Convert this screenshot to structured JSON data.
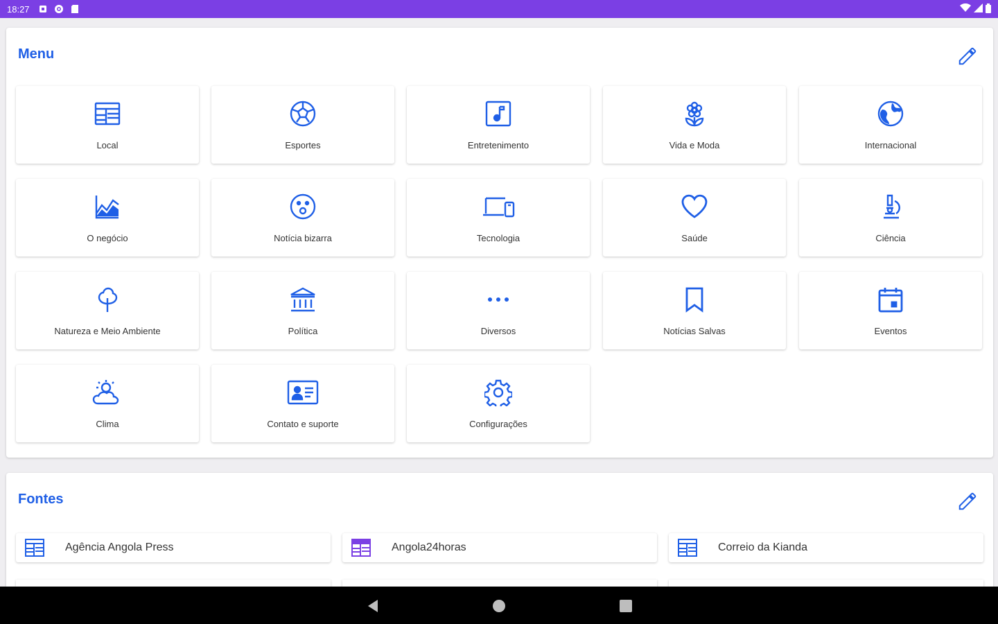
{
  "status_bar": {
    "time": "18:27"
  },
  "menu": {
    "title": "Menu",
    "items": [
      {
        "label": "Local",
        "icon": "local-news-icon"
      },
      {
        "label": "Esportes",
        "icon": "soccer-ball-icon"
      },
      {
        "label": "Entretenimento",
        "icon": "music-note-icon"
      },
      {
        "label": "Vida e Moda",
        "icon": "flower-icon"
      },
      {
        "label": "Internacional",
        "icon": "globe-icon"
      },
      {
        "label": "O negócio",
        "icon": "chart-icon"
      },
      {
        "label": "Notícia bizarra",
        "icon": "surprised-face-icon"
      },
      {
        "label": "Tecnologia",
        "icon": "devices-icon"
      },
      {
        "label": "Saúde",
        "icon": "heart-icon"
      },
      {
        "label": "Ciência",
        "icon": "microscope-icon"
      },
      {
        "label": "Natureza e Meio Ambiente",
        "icon": "tree-icon"
      },
      {
        "label": "Política",
        "icon": "institution-icon"
      },
      {
        "label": "Diversos",
        "icon": "more-dots-icon"
      },
      {
        "label": "Notícias Salvas",
        "icon": "bookmark-icon"
      },
      {
        "label": "Eventos",
        "icon": "calendar-icon"
      },
      {
        "label": "Clima",
        "icon": "weather-icon"
      },
      {
        "label": "Contato e suporte",
        "icon": "contact-card-icon"
      },
      {
        "label": "Configurações",
        "icon": "gear-icon"
      }
    ]
  },
  "fontes": {
    "title": "Fontes",
    "items": [
      {
        "label": "Agência Angola Press",
        "icon": "news-source-icon",
        "color": "#1f5fe6"
      },
      {
        "label": "Angola24horas",
        "icon": "news-source-icon",
        "color": "#7b3fe4"
      },
      {
        "label": "Correio da Kianda",
        "icon": "news-source-icon",
        "color": "#1f5fe6"
      }
    ]
  },
  "colors": {
    "accent": "#1f5fe6",
    "status_bar": "#7b3fe4",
    "nav_bar": "#000000"
  }
}
